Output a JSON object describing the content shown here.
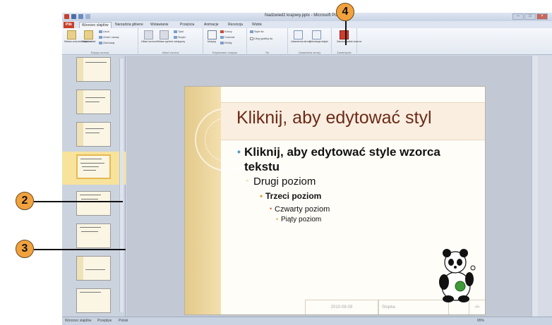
{
  "window": {
    "title": "Nadzwiedź krajowy.pptx - Microsoft PowerPoint"
  },
  "tabs": [
    {
      "label": "Plik",
      "kind": "file"
    },
    {
      "label": "Wzorzec slajdów",
      "kind": "active"
    },
    {
      "label": "Narzędzia główne",
      "kind": "normal"
    },
    {
      "label": "Wstawianie",
      "kind": "normal"
    },
    {
      "label": "Przejścia",
      "kind": "normal"
    },
    {
      "label": "Animacje",
      "kind": "normal"
    },
    {
      "label": "Recenzja",
      "kind": "normal"
    },
    {
      "label": "Widok",
      "kind": "normal"
    }
  ],
  "ribbon": {
    "groups": [
      {
        "label": "Edycja wzorca"
      },
      {
        "label": "Układ wzorca"
      },
      {
        "label": "Edytowanie motywu"
      },
      {
        "label": "Tło"
      },
      {
        "label": "Ustawienia strony"
      },
      {
        "label": "Zamknięcie"
      }
    ],
    "buttons": {
      "insert_master": "Wstaw wzorzec slajdów",
      "insert_layout": "Wstaw układ",
      "delete": "Usuń",
      "rename": "Zmień nazwę",
      "preserve": "Zachowaj",
      "master_layout": "Układ wzorca",
      "insert_placeholder": "Wstaw symbol zastępczy",
      "title": "Tytuł",
      "footers": "Stopki",
      "themes": "Motywy",
      "colors": "Kolory",
      "fonts": "Czcionki",
      "effects": "Efekty",
      "bg_styles": "Style tła",
      "hide_bg": "Ukryj grafikę tła",
      "page_setup": "Ustawienia strony",
      "orientation": "Orientacja slajdu",
      "close_master": "Zamknij widok wzorca"
    }
  },
  "slide": {
    "title": "Kliknij, aby edytować styl",
    "level1": "Kliknij, aby edytować style wzorca tekstu",
    "level2": "Drugi poziom",
    "level3": "Trzeci poziom",
    "level4": "Czwarty poziom",
    "level5": "Piąty poziom",
    "footer_date": "2010-08-09",
    "footer_text": "Stopka",
    "footer_num": "‹#›"
  },
  "status": {
    "view": "Wzorzec slajdów",
    "theme": "Przepływ",
    "language": "Polski",
    "zoom": "65%"
  },
  "callouts": [
    "2",
    "3",
    "4"
  ]
}
